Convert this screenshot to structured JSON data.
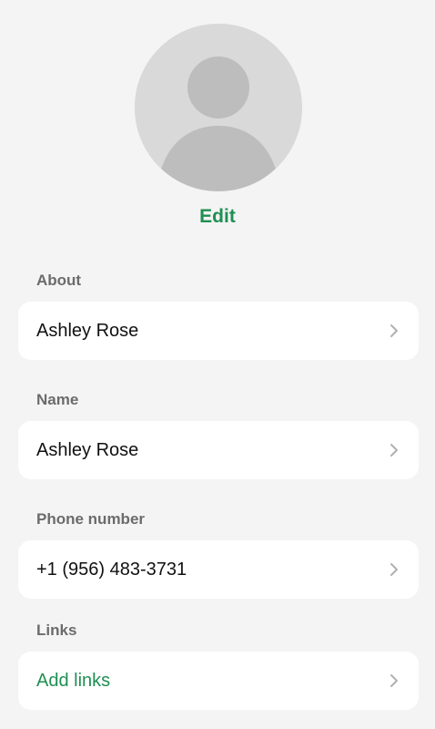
{
  "profile": {
    "edit_label": "Edit"
  },
  "sections": [
    {
      "label": "About",
      "value": "Ashley Rose"
    },
    {
      "label": "Name",
      "value": "Ashley Rose"
    },
    {
      "label": "Phone number",
      "value": "+1 (956) 483-3731"
    },
    {
      "label": "Links",
      "value": "Add links"
    }
  ],
  "colors": {
    "accent": "#1f8f52",
    "background": "#f4f4f4",
    "card": "#ffffff",
    "label": "#6b6b6b",
    "chevron": "#b0b0b0"
  },
  "icons": {
    "row_chevron": "chevron-right-icon"
  }
}
